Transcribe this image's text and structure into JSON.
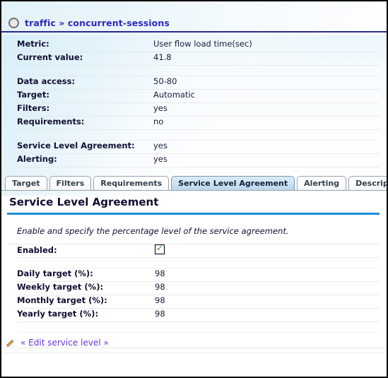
{
  "breadcrumb": {
    "icon": "circle-icon",
    "text": "traffic » concurrent-sessions"
  },
  "details": [
    {
      "label": "Metric:",
      "value": "User flow load time(sec)"
    },
    {
      "label": "Current value:",
      "value": "41.8"
    },
    {
      "label": "",
      "value": ""
    },
    {
      "label": "Data access:",
      "value": "50-80"
    },
    {
      "label": "Target:",
      "value": "Automatic"
    },
    {
      "label": "Filters:",
      "value": "yes"
    },
    {
      "label": "Requirements:",
      "value": "no"
    },
    {
      "label": "",
      "value": ""
    },
    {
      "label": "Service Level Agreement:",
      "value": "yes"
    },
    {
      "label": "Alerting:",
      "value": "yes"
    }
  ],
  "tabs": [
    {
      "label": "Target",
      "active": false
    },
    {
      "label": "Filters",
      "active": false
    },
    {
      "label": "Requirements",
      "active": false
    },
    {
      "label": "Service Level Agreement",
      "active": true
    },
    {
      "label": "Alerting",
      "active": false
    },
    {
      "label": "Description",
      "active": false
    }
  ],
  "section": {
    "title": "Service Level Agreement",
    "description": "Enable and specify the percentage level of the service agreement.",
    "enabled_label": "Enabled:",
    "enabled_checked": true,
    "checkbox_mark": "✓",
    "targets": [
      {
        "label": "Daily target (%):",
        "value": "98"
      },
      {
        "label": "Weekly target (%):",
        "value": "98"
      },
      {
        "label": "Monthly target (%):",
        "value": "98"
      },
      {
        "label": "Yearly target (%):",
        "value": "98"
      }
    ]
  },
  "footer": {
    "icon": "pencil-icon",
    "link": "« Edit service level »"
  },
  "colors": {
    "breadcrumb_text": "#2b2bbb",
    "breadcrumb_rule": "#2a2a8c",
    "section_rule": "#1b8fd4",
    "active_tab": "#cfe3f3",
    "link": "#6a36d9",
    "check": "#2a9a2a"
  }
}
